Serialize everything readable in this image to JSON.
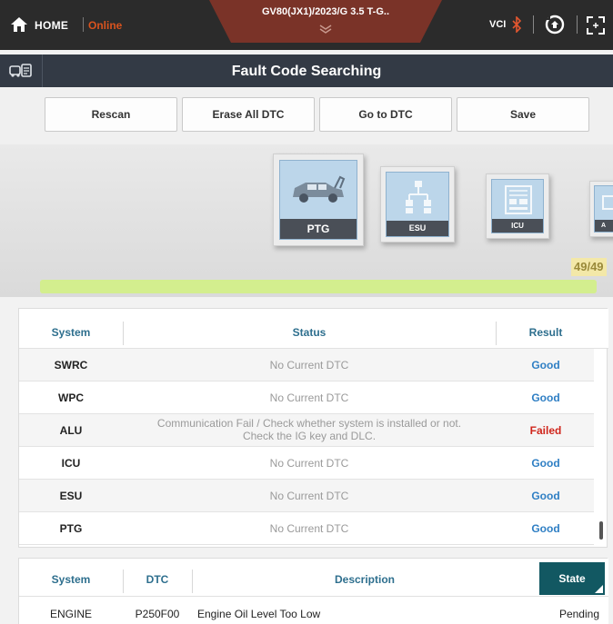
{
  "topbar": {
    "home_label": "HOME",
    "online_label": "Online",
    "vehicle": "GV80(JX1)/2023/G 3.5 T-G..",
    "vci_label": "VCI",
    "colors": {
      "online": "#d9531e",
      "vehicle_tab": "#7a3328",
      "bluetooth": "#e2562f"
    }
  },
  "titlebar": {
    "title": "Fault Code Searching"
  },
  "actions": {
    "rescan": "Rescan",
    "erase_all": "Erase All DTC",
    "go_to_dtc": "Go to DTC",
    "save": "Save"
  },
  "carousel": {
    "modules": [
      {
        "label": "PTG",
        "icon": "car-tailgate-icon"
      },
      {
        "label": "ESU",
        "icon": "network-icon"
      },
      {
        "label": "ICU",
        "icon": "control-unit-icon"
      },
      {
        "label": "A",
        "icon": "module-icon"
      }
    ],
    "counter": "49/49",
    "progress": 1.0
  },
  "systems": {
    "headers": {
      "system": "System",
      "status": "Status",
      "result": "Result"
    },
    "rows": [
      {
        "system": "SWRC",
        "status": "No Current DTC",
        "status_line2": "",
        "result": "Good",
        "result_color": "#2f7fc4"
      },
      {
        "system": "WPC",
        "status": "No Current DTC",
        "status_line2": "",
        "result": "Good",
        "result_color": "#2f7fc4"
      },
      {
        "system": "ALU",
        "status": "Communication Fail / Check whether system is installed or not.",
        "status_line2": "Check the IG key and DLC.",
        "result": "Failed",
        "result_color": "#d0261c"
      },
      {
        "system": "ICU",
        "status": "No Current DTC",
        "status_line2": "",
        "result": "Good",
        "result_color": "#2f7fc4"
      },
      {
        "system": "ESU",
        "status": "No Current DTC",
        "status_line2": "",
        "result": "Good",
        "result_color": "#2f7fc4"
      },
      {
        "system": "PTG",
        "status": "No Current DTC",
        "status_line2": "",
        "result": "Good",
        "result_color": "#2f7fc4"
      }
    ]
  },
  "dtc": {
    "headers": {
      "system": "System",
      "dtc": "DTC",
      "description": "Description",
      "state": "State"
    },
    "rows": [
      {
        "system": "ENGINE",
        "code": "P250F00",
        "description": "Engine Oil Level Too Low",
        "state": "Pending"
      }
    ]
  }
}
